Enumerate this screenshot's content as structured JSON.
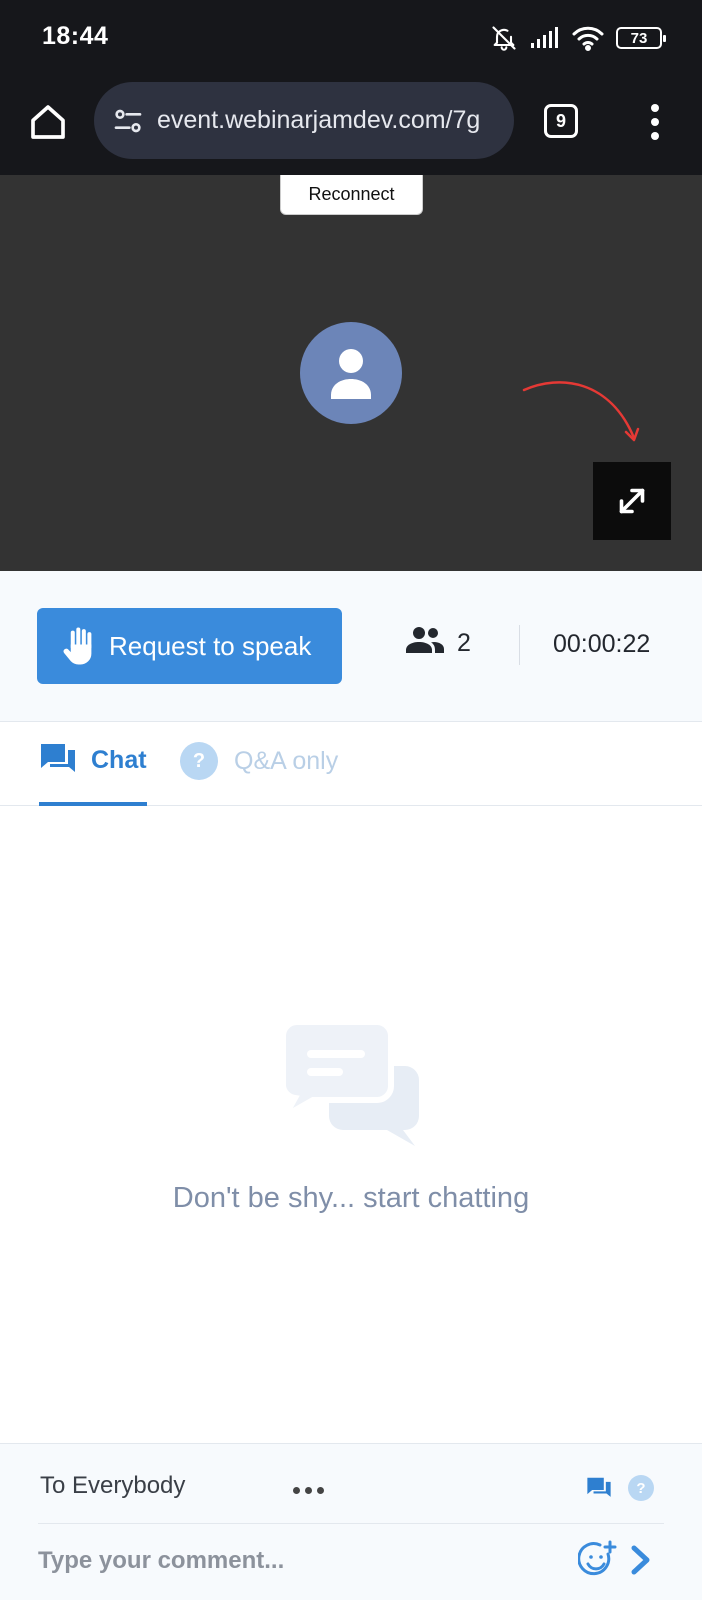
{
  "status_bar": {
    "time": "18:44",
    "battery": "73",
    "icons": [
      "bell-off-icon",
      "signal-icon",
      "wifi-icon",
      "battery-icon"
    ]
  },
  "browser": {
    "url": "event.webinarjamdev.com/7g",
    "tab_count": "9",
    "icons": [
      "home-icon",
      "site-settings-icon",
      "tabs-icon",
      "more-vert-icon"
    ]
  },
  "video": {
    "reconnect_label": "Reconnect",
    "icons": [
      "avatar-icon",
      "fullscreen-icon",
      "annotation-arrow"
    ],
    "annotation_color": "#e53935"
  },
  "controls": {
    "request_label": "Request to speak",
    "participants_count": "2",
    "timer": "00:00:22",
    "accent": "#3a8bdc"
  },
  "tabs": [
    {
      "label": "Chat",
      "active": true,
      "icon": "chat-icon"
    },
    {
      "label": "Q&A only",
      "active": false,
      "icon": "question-icon",
      "icon_text": "?"
    }
  ],
  "chat": {
    "empty_text": "Don't be shy... start chatting",
    "empty_icon": "chat-bubbles-icon"
  },
  "footer": {
    "recipient": "To Everybody",
    "comment_placeholder": "Type your comment...",
    "qa_icon_text": "?",
    "icons": [
      "more-horizontal-icon",
      "chat-mode-icon",
      "qa-mode-icon",
      "emoji-icon",
      "send-icon"
    ]
  }
}
